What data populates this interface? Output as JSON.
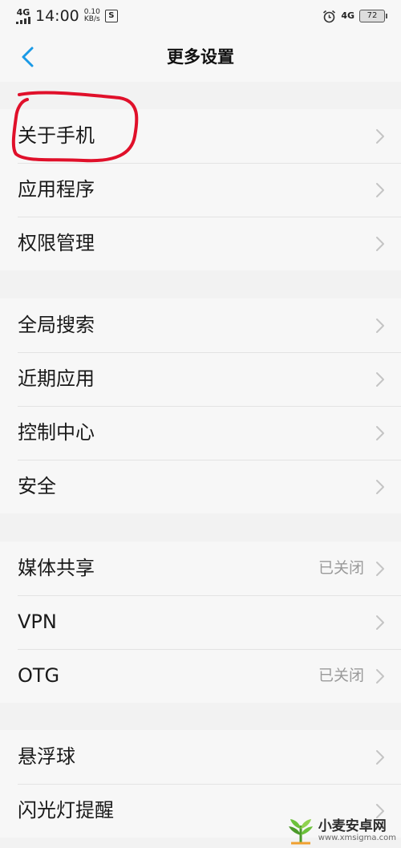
{
  "status_bar": {
    "network": "4G",
    "time": "14:00",
    "speed_value": "0.10",
    "speed_unit": "KB/s",
    "app_icon": "S",
    "right_network": "4G",
    "battery": "72"
  },
  "header": {
    "title": "更多设置",
    "back_icon": "chevron-left-icon"
  },
  "groups": [
    {
      "items": [
        {
          "label": "关于手机",
          "value": ""
        },
        {
          "label": "应用程序",
          "value": ""
        },
        {
          "label": "权限管理",
          "value": ""
        }
      ]
    },
    {
      "items": [
        {
          "label": "全局搜索",
          "value": ""
        },
        {
          "label": "近期应用",
          "value": ""
        },
        {
          "label": "控制中心",
          "value": ""
        },
        {
          "label": "安全",
          "value": ""
        }
      ]
    },
    {
      "items": [
        {
          "label": "媒体共享",
          "value": "已关闭"
        },
        {
          "label": "VPN",
          "value": ""
        },
        {
          "label": "OTG",
          "value": "已关闭"
        }
      ]
    },
    {
      "items": [
        {
          "label": "悬浮球",
          "value": ""
        },
        {
          "label": "闪光灯提醒",
          "value": ""
        }
      ]
    }
  ],
  "watermark": {
    "name": "小麦安卓网",
    "url": "www.xmsigma.com"
  },
  "colors": {
    "accent": "#1a9ae6",
    "annotation": "#e0102a",
    "background": "#f2f2f2",
    "card": "#f7f7f7"
  }
}
